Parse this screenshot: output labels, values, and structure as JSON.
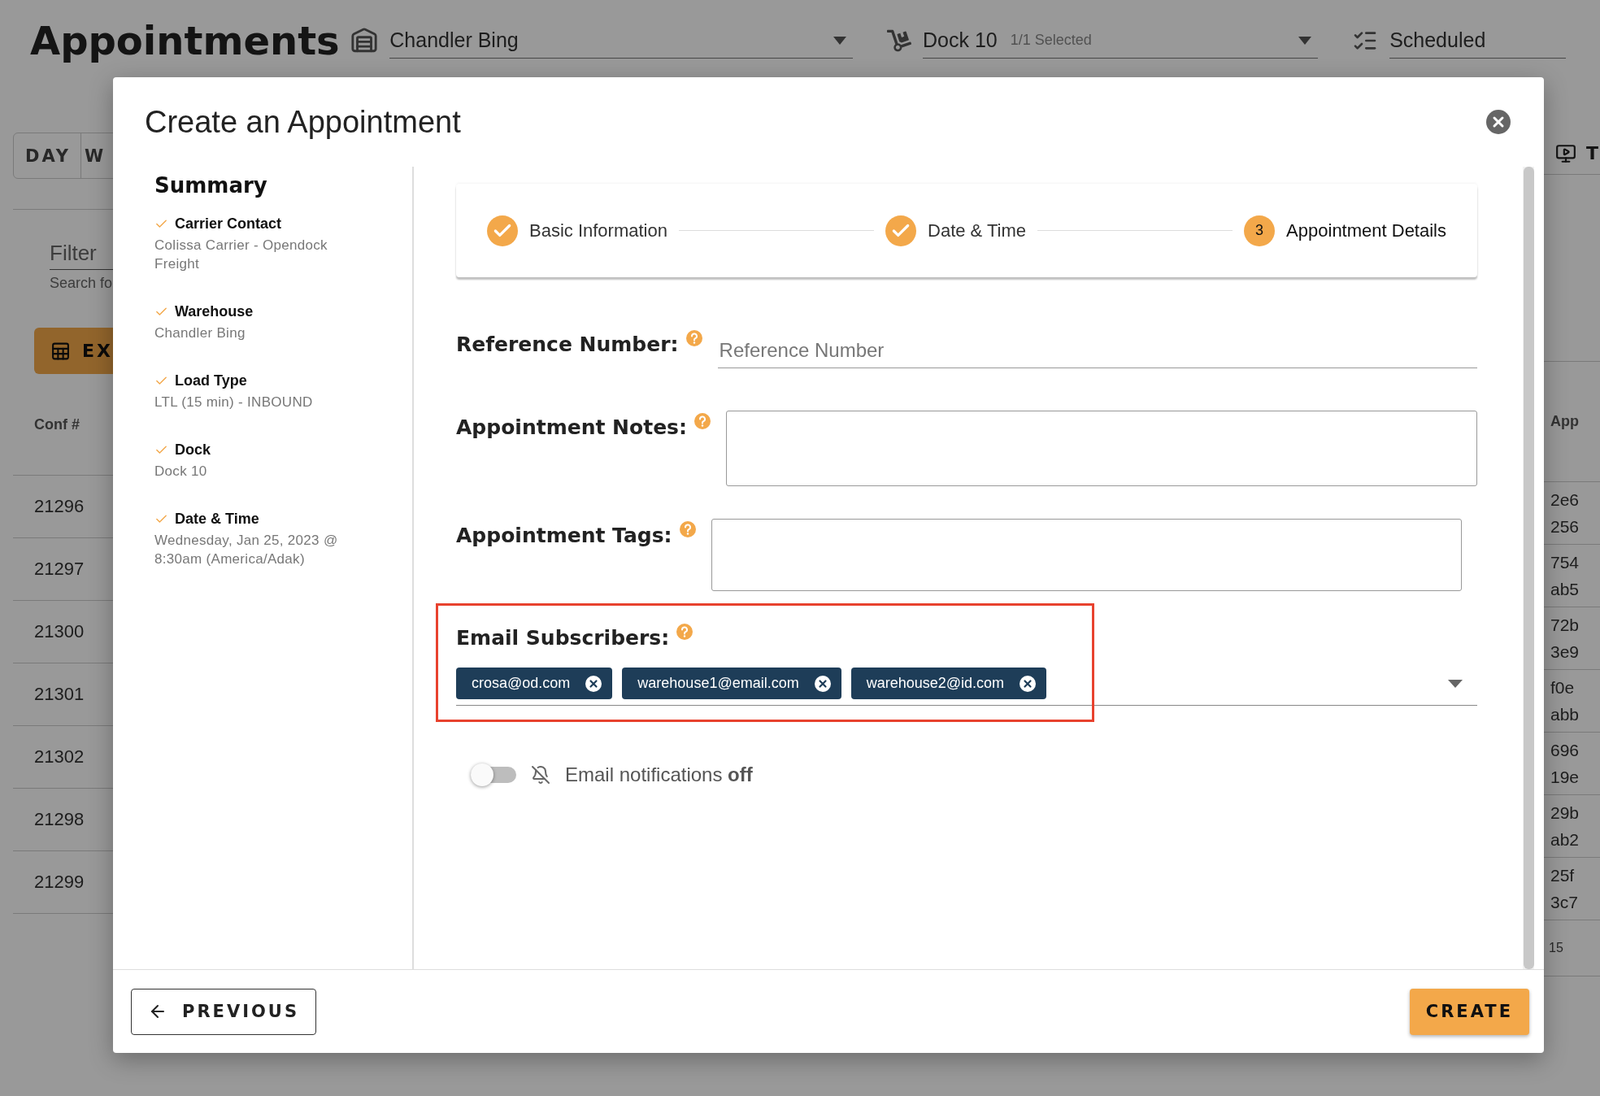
{
  "page": {
    "title": "Appointments",
    "warehouse_select": {
      "value": "Chandler Bing"
    },
    "dock_select": {
      "value": "Dock 10",
      "hint": "1/1 Selected"
    },
    "status_select": {
      "value": "Scheduled"
    },
    "view_tabs": [
      {
        "label": "DAY",
        "selected": false
      },
      {
        "label": "W",
        "selected": false
      }
    ],
    "filter": {
      "label": "Filter",
      "hint": "Search fo"
    },
    "export_button": {
      "label": "EX"
    },
    "toolbar_button": {
      "label": "T"
    },
    "table": {
      "columns": [
        "Conf #",
        "App"
      ],
      "rows": [
        {
          "conf": "21296",
          "column_2": [
            "2e6",
            "256"
          ]
        },
        {
          "conf": "21297",
          "column_2": [
            "754",
            "ab5"
          ]
        },
        {
          "conf": "21300",
          "column_2": [
            "72b",
            "3e9"
          ]
        },
        {
          "conf": "21301",
          "column_2": [
            "f0e",
            "abb"
          ]
        },
        {
          "conf": "21302",
          "column_2": [
            "696",
            "19e"
          ]
        },
        {
          "conf": "21298",
          "column_2": [
            "29b",
            "ab2"
          ]
        },
        {
          "conf": "21299",
          "column_2": [
            "25f",
            "3c7"
          ]
        }
      ],
      "footer": "15"
    }
  },
  "dialog": {
    "title": "Create an Appointment",
    "summary": {
      "title": "Summary",
      "items": [
        {
          "label": "Carrier Contact",
          "value": "Colissa Carrier - Opendock Freight"
        },
        {
          "label": "Warehouse",
          "value": "Chandler Bing"
        },
        {
          "label": "Load Type",
          "value": "LTL (15 min) - INBOUND"
        },
        {
          "label": "Dock",
          "value": "Dock 10"
        },
        {
          "label": "Date & Time",
          "value": "Wednesday, Jan 25, 2023 @ 8:30am (America/Adak)"
        }
      ]
    },
    "steps": [
      {
        "label": "Basic Information",
        "completed": true
      },
      {
        "label": "Date & Time",
        "completed": true
      },
      {
        "label": "Appointment Details",
        "completed": false,
        "number": "3"
      }
    ],
    "reference_number": {
      "label": "Reference Number:",
      "placeholder": "Reference Number"
    },
    "appointment_notes": {
      "label": "Appointment Notes:"
    },
    "appointment_tags": {
      "label": "Appointment Tags:"
    },
    "email_subscribers": {
      "label": "Email Subscribers:",
      "highlighted": true,
      "chips": [
        "crosa@od.com",
        "warehouse1@email.com",
        "warehouse2@id.com"
      ]
    },
    "notifications": {
      "on": false,
      "label": "Email notifications",
      "state_text": "off"
    },
    "previous_button": "PREVIOUS",
    "create_button": "CREATE"
  }
}
